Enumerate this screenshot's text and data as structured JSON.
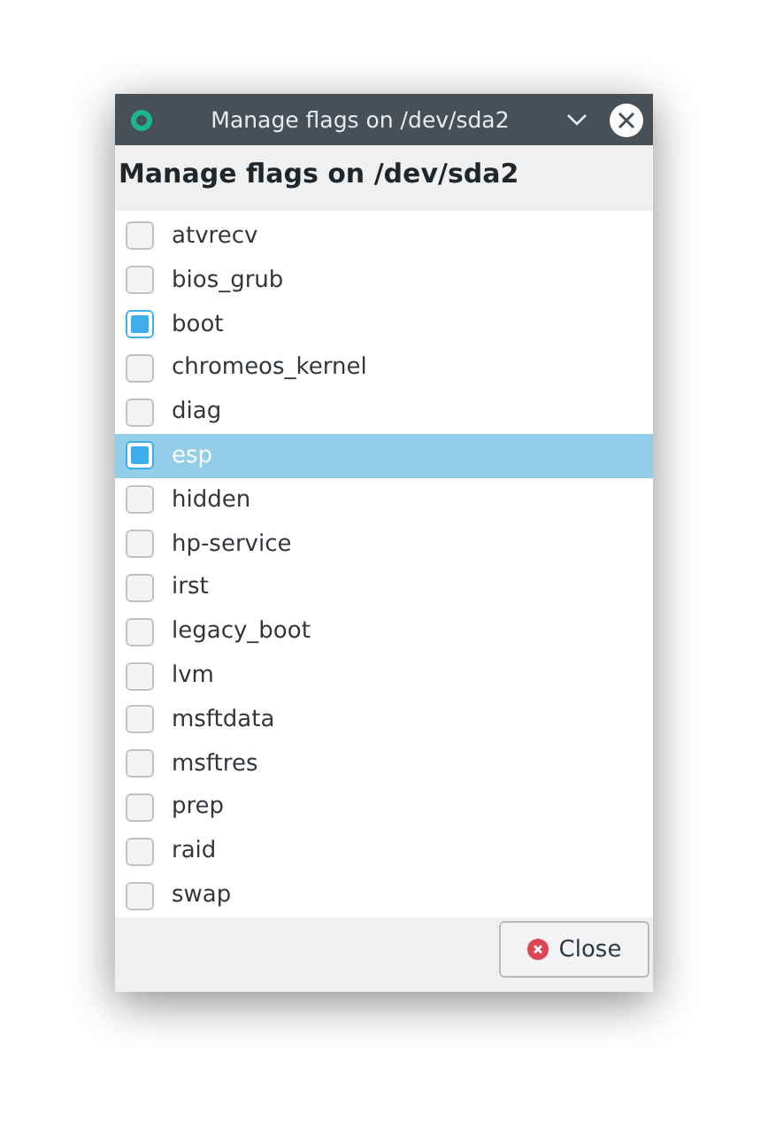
{
  "window": {
    "title": "Manage flags on /dev/sda2"
  },
  "heading": "Manage flags on /dev/sda2",
  "flags": [
    {
      "label": "atvrecv",
      "checked": false,
      "selected": false
    },
    {
      "label": "bios_grub",
      "checked": false,
      "selected": false
    },
    {
      "label": "boot",
      "checked": true,
      "selected": false
    },
    {
      "label": "chromeos_kernel",
      "checked": false,
      "selected": false
    },
    {
      "label": "diag",
      "checked": false,
      "selected": false
    },
    {
      "label": "esp",
      "checked": true,
      "selected": true
    },
    {
      "label": "hidden",
      "checked": false,
      "selected": false
    },
    {
      "label": "hp-service",
      "checked": false,
      "selected": false
    },
    {
      "label": "irst",
      "checked": false,
      "selected": false
    },
    {
      "label": "legacy_boot",
      "checked": false,
      "selected": false
    },
    {
      "label": "lvm",
      "checked": false,
      "selected": false
    },
    {
      "label": "msftdata",
      "checked": false,
      "selected": false
    },
    {
      "label": "msftres",
      "checked": false,
      "selected": false
    },
    {
      "label": "prep",
      "checked": false,
      "selected": false
    },
    {
      "label": "raid",
      "checked": false,
      "selected": false
    },
    {
      "label": "swap",
      "checked": false,
      "selected": false
    }
  ],
  "buttons": [
    "Close"
  ]
}
